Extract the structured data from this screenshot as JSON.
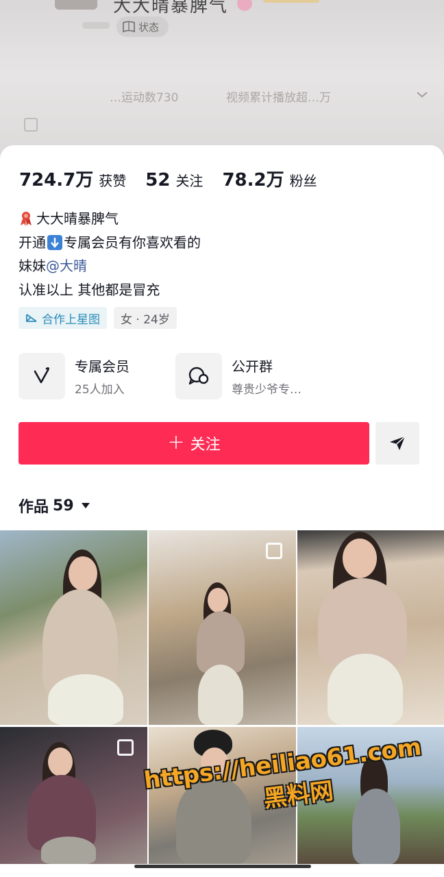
{
  "header": {
    "username": "大大晴暴脾气",
    "status_label": "状态",
    "blurred_left_metric": "…运动数730",
    "blurred_right_metric": "视频累计播放超…万"
  },
  "stats": [
    {
      "value": "724.7万",
      "label": "获赞"
    },
    {
      "value": "52",
      "label": "关注"
    },
    {
      "value": "78.2万",
      "label": "粉丝"
    }
  ],
  "bio": {
    "line1": "大大晴暴脾气",
    "line2_prefix": "开通",
    "line2_suffix": "专属会员有你喜欢看的",
    "line3_prefix": "妹妹",
    "line3_mention": "@大晴",
    "line4": "认准以上 其他都是冒充"
  },
  "tags": {
    "partner": "合作上星图",
    "profile": "女 · 24岁"
  },
  "features": [
    {
      "title": "专属会员",
      "subtitle": "25人加入",
      "icon": "v-badge-icon"
    },
    {
      "title": "公开群",
      "subtitle": "尊贵少爷专…",
      "icon": "group-chat-icon"
    }
  ],
  "actions": {
    "follow_label": "关注",
    "share_icon": "send-icon"
  },
  "works": {
    "label": "作品",
    "count": "59"
  },
  "watermark": {
    "url": "https://heiliao61.com",
    "name": "黑料网"
  },
  "colors": {
    "primary": "#fe2c55",
    "link": "#3d5a99",
    "tag_blue": "#2b8cb9",
    "watermark": "#f5a623"
  }
}
